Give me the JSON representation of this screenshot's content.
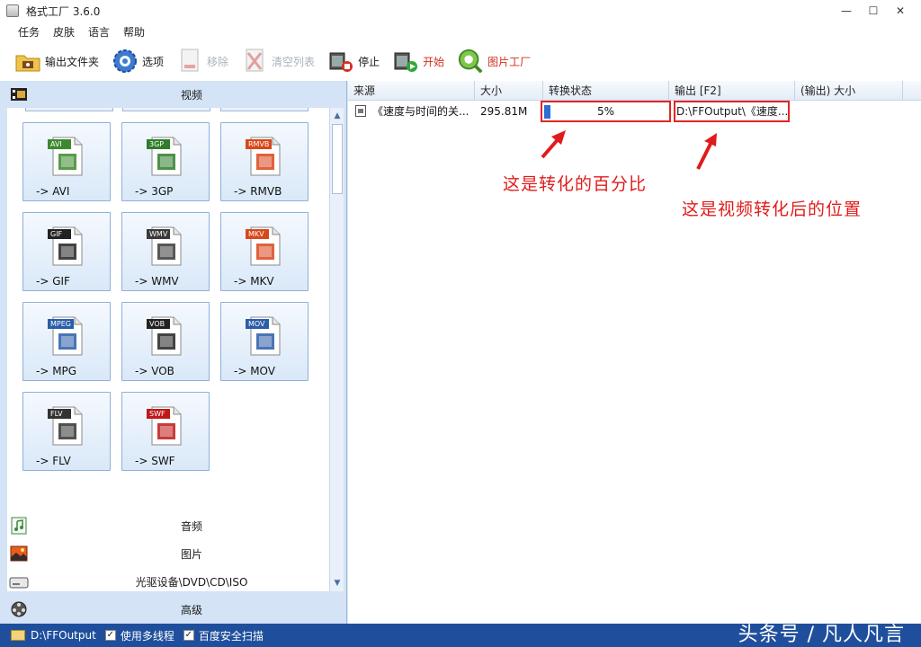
{
  "window": {
    "title": "格式工厂 3.6.0",
    "minimize": "—",
    "maximize": "☐",
    "close": "✕"
  },
  "menu": [
    "任务",
    "皮肤",
    "语言",
    "帮助"
  ],
  "toolbar": {
    "output_folder": "输出文件夹",
    "options": "选项",
    "remove": "移除",
    "clear_list": "清空列表",
    "stop": "停止",
    "start": "开始",
    "picture_factory": "图片工厂"
  },
  "categories": {
    "video": "视频",
    "audio": "音频",
    "picture": "图片",
    "rom": "光驱设备\\DVD\\CD\\ISO",
    "advanced": "高级"
  },
  "formats": [
    {
      "tag": "AVI",
      "label": "-> AVI",
      "color": "#3c8a2e"
    },
    {
      "tag": "3GP",
      "label": "-> 3GP",
      "color": "#2f7d2a"
    },
    {
      "tag": "RMVB",
      "label": "-> RMVB",
      "color": "#d9471b"
    },
    {
      "tag": "GIF",
      "label": "-> GIF",
      "color": "#222222"
    },
    {
      "tag": "WMV",
      "label": "-> WMV",
      "color": "#3a3a3a"
    },
    {
      "tag": "MKV",
      "label": "-> MKV",
      "color": "#d9471b"
    },
    {
      "tag": "MPEG",
      "label": "-> MPG",
      "color": "#2a5da8"
    },
    {
      "tag": "VOB",
      "label": "-> VOB",
      "color": "#222222"
    },
    {
      "tag": "MOV",
      "label": "-> MOV",
      "color": "#2a5da8"
    },
    {
      "tag": "FLV",
      "label": "-> FLV",
      "color": "#333333"
    },
    {
      "tag": "SWF",
      "label": "-> SWF",
      "color": "#c01818"
    }
  ],
  "table": {
    "headers": [
      "来源",
      "大小",
      "转换状态",
      "输出 [F2]",
      "(输出) 大小"
    ],
    "rows": [
      {
        "source": "《速度与时间的关...",
        "size": "295.81M",
        "progress": 0.05,
        "progress_text": "5%",
        "output": "D:\\FFOutput\\《速度...",
        "output_size": ""
      }
    ]
  },
  "annotations": {
    "percent_note": "这是转化的百分比",
    "location_note": "这是视频转化后的位置"
  },
  "statusbar": {
    "path": "D:\\FFOutput",
    "multithread": "使用多线程",
    "baidu_scan": "百度安全扫描",
    "watermark": "头条号 / 凡人凡言"
  },
  "colors": {
    "accent": "#1f4f9c",
    "annotation": "#e11b1b",
    "progress": "#2d6fd6"
  }
}
